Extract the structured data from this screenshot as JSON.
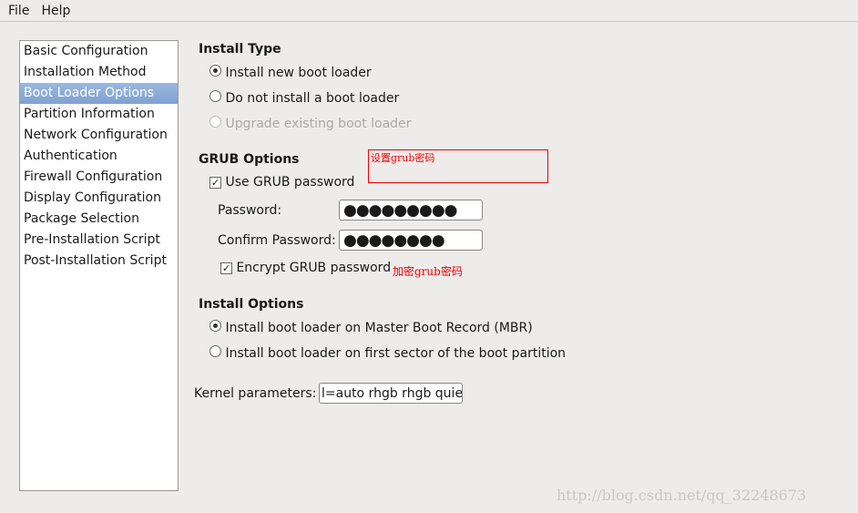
{
  "menu": {
    "file": "File",
    "help": "Help"
  },
  "sidebar": {
    "items": [
      {
        "label": "Basic Configuration"
      },
      {
        "label": "Installation Method"
      },
      {
        "label": "Boot Loader Options",
        "selected": true
      },
      {
        "label": "Partition Information"
      },
      {
        "label": "Network Configuration"
      },
      {
        "label": "Authentication"
      },
      {
        "label": "Firewall Configuration"
      },
      {
        "label": "Display Configuration"
      },
      {
        "label": "Package Selection"
      },
      {
        "label": "Pre-Installation Script"
      },
      {
        "label": "Post-Installation Script"
      }
    ]
  },
  "install_type": {
    "title": "Install Type",
    "options": [
      "Install new boot loader",
      "Do not install a boot loader",
      "Upgrade existing boot loader"
    ],
    "selected": 0
  },
  "grub": {
    "title": "GRUB Options",
    "use_password": "Use GRUB password",
    "password_label": "Password:",
    "password_value": "●●●●●●●●●",
    "confirm_label": "Confirm Password:",
    "confirm_value": "●●●●●●●●",
    "encrypt": "Encrypt GRUB password",
    "annotation_set": "设置grub密码",
    "annotation_encrypt": "加密grub密码"
  },
  "install_options": {
    "title": "Install Options",
    "options": [
      "Install boot loader on Master Boot Record (MBR)",
      "Install boot loader on first sector of the boot partition"
    ],
    "selected": 0
  },
  "kernel": {
    "label": "Kernel parameters:",
    "value": "l=auto rhgb rhgb quiet"
  },
  "watermark": "http://blog.csdn.net/qq_32248673",
  "colors": {
    "selection": "#8aaedb",
    "annotation": "#ee0000"
  }
}
